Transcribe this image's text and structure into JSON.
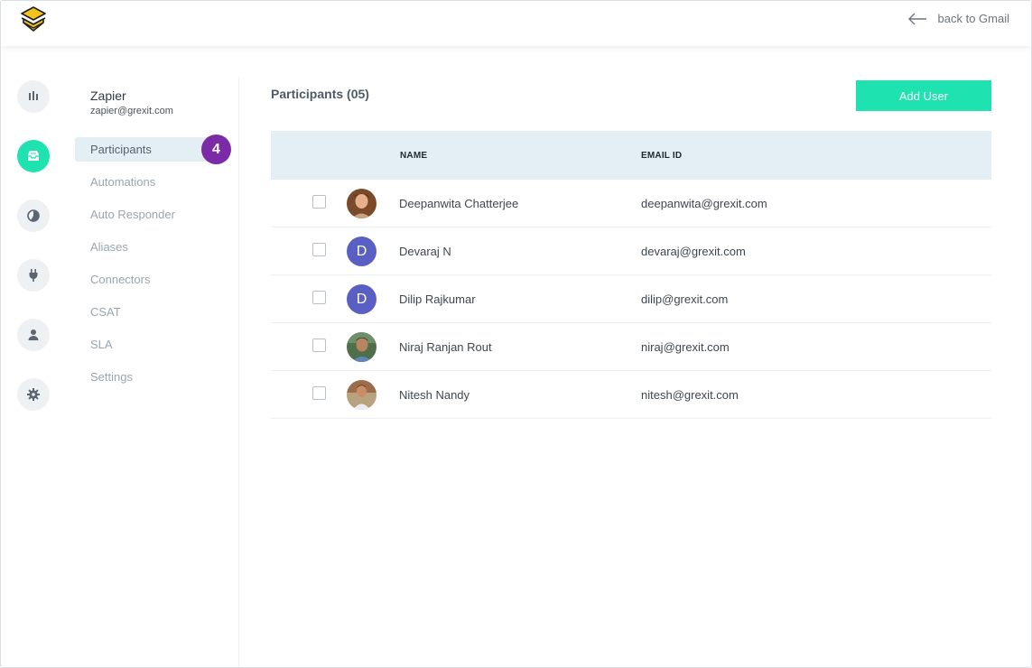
{
  "header": {
    "back_label": "back to Gmail"
  },
  "account": {
    "name": "Zapier",
    "email": "zapier@grexit.com"
  },
  "nav": {
    "items": [
      {
        "label": "Participants"
      },
      {
        "label": "Automations"
      },
      {
        "label": "Auto Responder"
      },
      {
        "label": "Aliases"
      },
      {
        "label": "Connectors"
      },
      {
        "label": "CSAT"
      },
      {
        "label": "SLA"
      },
      {
        "label": "Settings"
      }
    ],
    "step_badge": "4"
  },
  "rail": {
    "icons": [
      "chart-bars-icon",
      "inbox-icon",
      "pie-chart-icon",
      "plug-icon",
      "user-icon",
      "gear-icon"
    ]
  },
  "main": {
    "title": "Participants (05)",
    "add_button": "Add User",
    "columns": {
      "name": "NAME",
      "email": "EMAIL ID"
    },
    "rows": [
      {
        "name": "Deepanwita Chatterjee",
        "email": "deepanwita@grexit.com",
        "avatar": "photo"
      },
      {
        "name": "Devaraj N",
        "email": "devaraj@grexit.com",
        "avatar": "D"
      },
      {
        "name": "Dilip Rajkumar",
        "email": "dilip@grexit.com",
        "avatar": "D"
      },
      {
        "name": "Niraj Ranjan Rout",
        "email": "niraj@grexit.com",
        "avatar": "photo"
      },
      {
        "name": "Nitesh Nandy",
        "email": "nitesh@grexit.com",
        "avatar": "photo"
      }
    ]
  },
  "colors": {
    "accent": "#1ee3b0",
    "badge": "#7b2ba6",
    "table_header": "#e4eef5",
    "letter_avatar": "#5a5fc4"
  }
}
